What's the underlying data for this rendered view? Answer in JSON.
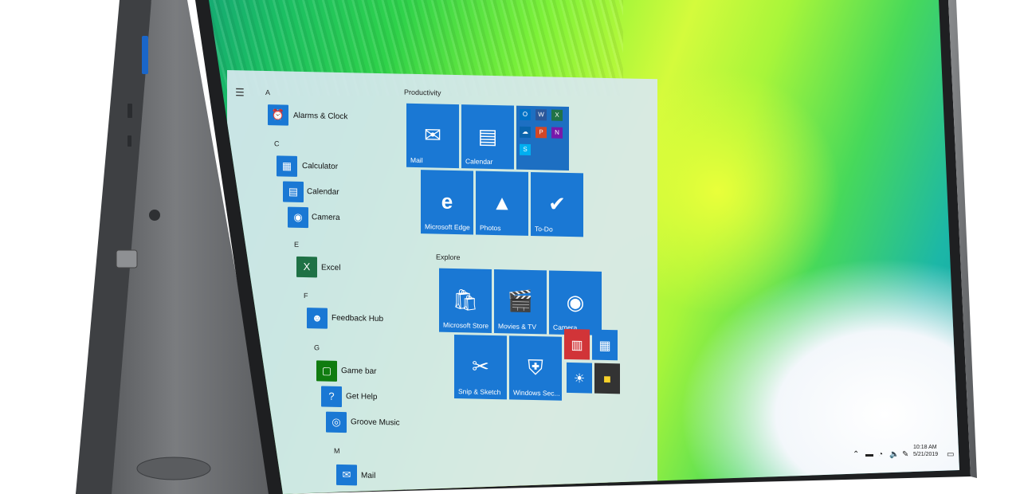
{
  "start_menu": {
    "app_list": [
      {
        "letter": "A",
        "apps": [
          {
            "name": "Alarms & Clock",
            "icon": "alarm-clock-icon"
          }
        ]
      },
      {
        "letter": "C",
        "apps": [
          {
            "name": "Calculator",
            "icon": "calculator-icon"
          },
          {
            "name": "Calendar",
            "icon": "calendar-icon"
          },
          {
            "name": "Camera",
            "icon": "camera-icon"
          }
        ]
      },
      {
        "letter": "E",
        "apps": [
          {
            "name": "Excel",
            "icon": "excel-icon"
          }
        ]
      },
      {
        "letter": "F",
        "apps": [
          {
            "name": "Feedback Hub",
            "icon": "feedback-icon"
          }
        ]
      },
      {
        "letter": "G",
        "apps": [
          {
            "name": "Game bar",
            "icon": "game-bar-icon"
          },
          {
            "name": "Get Help",
            "icon": "help-icon"
          },
          {
            "name": "Groove Music",
            "icon": "music-icon"
          }
        ]
      },
      {
        "letter": "M",
        "apps": [
          {
            "name": "Mail",
            "icon": "mail-icon"
          }
        ]
      }
    ],
    "groups": [
      {
        "title": "Productivity",
        "tiles": [
          {
            "label": "Mail",
            "icon": "mail-icon"
          },
          {
            "label": "Calendar",
            "icon": "calendar-icon"
          },
          {
            "label": "",
            "icon": "office-apps-icon"
          },
          {
            "label": "Microsoft Edge",
            "icon": "edge-icon"
          },
          {
            "label": "Photos",
            "icon": "photos-icon"
          },
          {
            "label": "To-Do",
            "icon": "checkmark-icon"
          }
        ]
      },
      {
        "title": "Explore",
        "tiles": [
          {
            "label": "Microsoft Store",
            "icon": "store-icon"
          },
          {
            "label": "Movies & TV",
            "icon": "movies-icon"
          },
          {
            "label": "Camera",
            "icon": "camera-icon"
          },
          {
            "label": "Snip & Sketch",
            "icon": "snip-icon"
          },
          {
            "label": "Windows Sec...",
            "icon": "shield-icon"
          },
          {
            "label": "",
            "icon": "small-apps-icon"
          }
        ]
      }
    ]
  },
  "taskbar": {
    "time": "10:18 AM",
    "date": "5/21/2019",
    "tray_icons": [
      "chevron-up-icon",
      "battery-icon",
      "network-icon",
      "volume-icon",
      "pen-icon",
      "notification-icon"
    ]
  },
  "colors": {
    "tile_blue": "#1a78d4",
    "start_bg": "#d8e8f0",
    "device_gray": "#6a6c6e"
  }
}
